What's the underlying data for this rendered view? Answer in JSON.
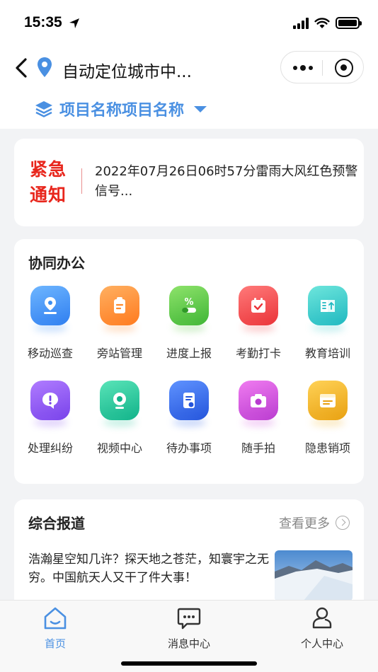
{
  "status_bar": {
    "time": "15:35"
  },
  "header": {
    "city_title": "自动定位城市中...",
    "project_name": "项目名称项目名称"
  },
  "notice": {
    "badge_line1": "紧急",
    "badge_line2": "通知",
    "text": "2022年07月26日06时57分雷雨大风红色预警信号..."
  },
  "office": {
    "title": "协同办公",
    "items": [
      {
        "label": "移动巡查",
        "icon": "location-icon",
        "color": "#3d8ef0"
      },
      {
        "label": "旁站管理",
        "icon": "clipboard-icon",
        "color": "#ff8a2a"
      },
      {
        "label": "进度上报",
        "icon": "percent-progress-icon",
        "color": "#55c548"
      },
      {
        "label": "考勤打卡",
        "icon": "calendar-check-icon",
        "color": "#f2484b"
      },
      {
        "label": "教育培训",
        "icon": "book-icon",
        "color": "#29c7c4"
      },
      {
        "label": "处理纠纷",
        "icon": "alert-chat-icon",
        "color": "#8b54f0"
      },
      {
        "label": "视频中心",
        "icon": "camera-icon",
        "color": "#1ec6a0"
      },
      {
        "label": "待办事项",
        "icon": "document-icon",
        "color": "#2f6df0"
      },
      {
        "label": "随手拍",
        "icon": "photo-camera-icon",
        "color": "#d24bd8"
      },
      {
        "label": "隐患销项",
        "icon": "browser-window-icon",
        "color": "#e8a91a"
      }
    ]
  },
  "news": {
    "title": "综合报道",
    "more_label": "查看更多",
    "headline": "浩瀚星空知几许？探天地之苍茫，知寰宇之无穷。中国航天人又干了件大事！"
  },
  "tabbar": {
    "tabs": [
      {
        "label": "首页",
        "active": true
      },
      {
        "label": "消息中心",
        "active": false
      },
      {
        "label": "个人中心",
        "active": false
      }
    ]
  },
  "colors": {
    "accent": "#4a90e2",
    "alert": "#e8261c"
  }
}
